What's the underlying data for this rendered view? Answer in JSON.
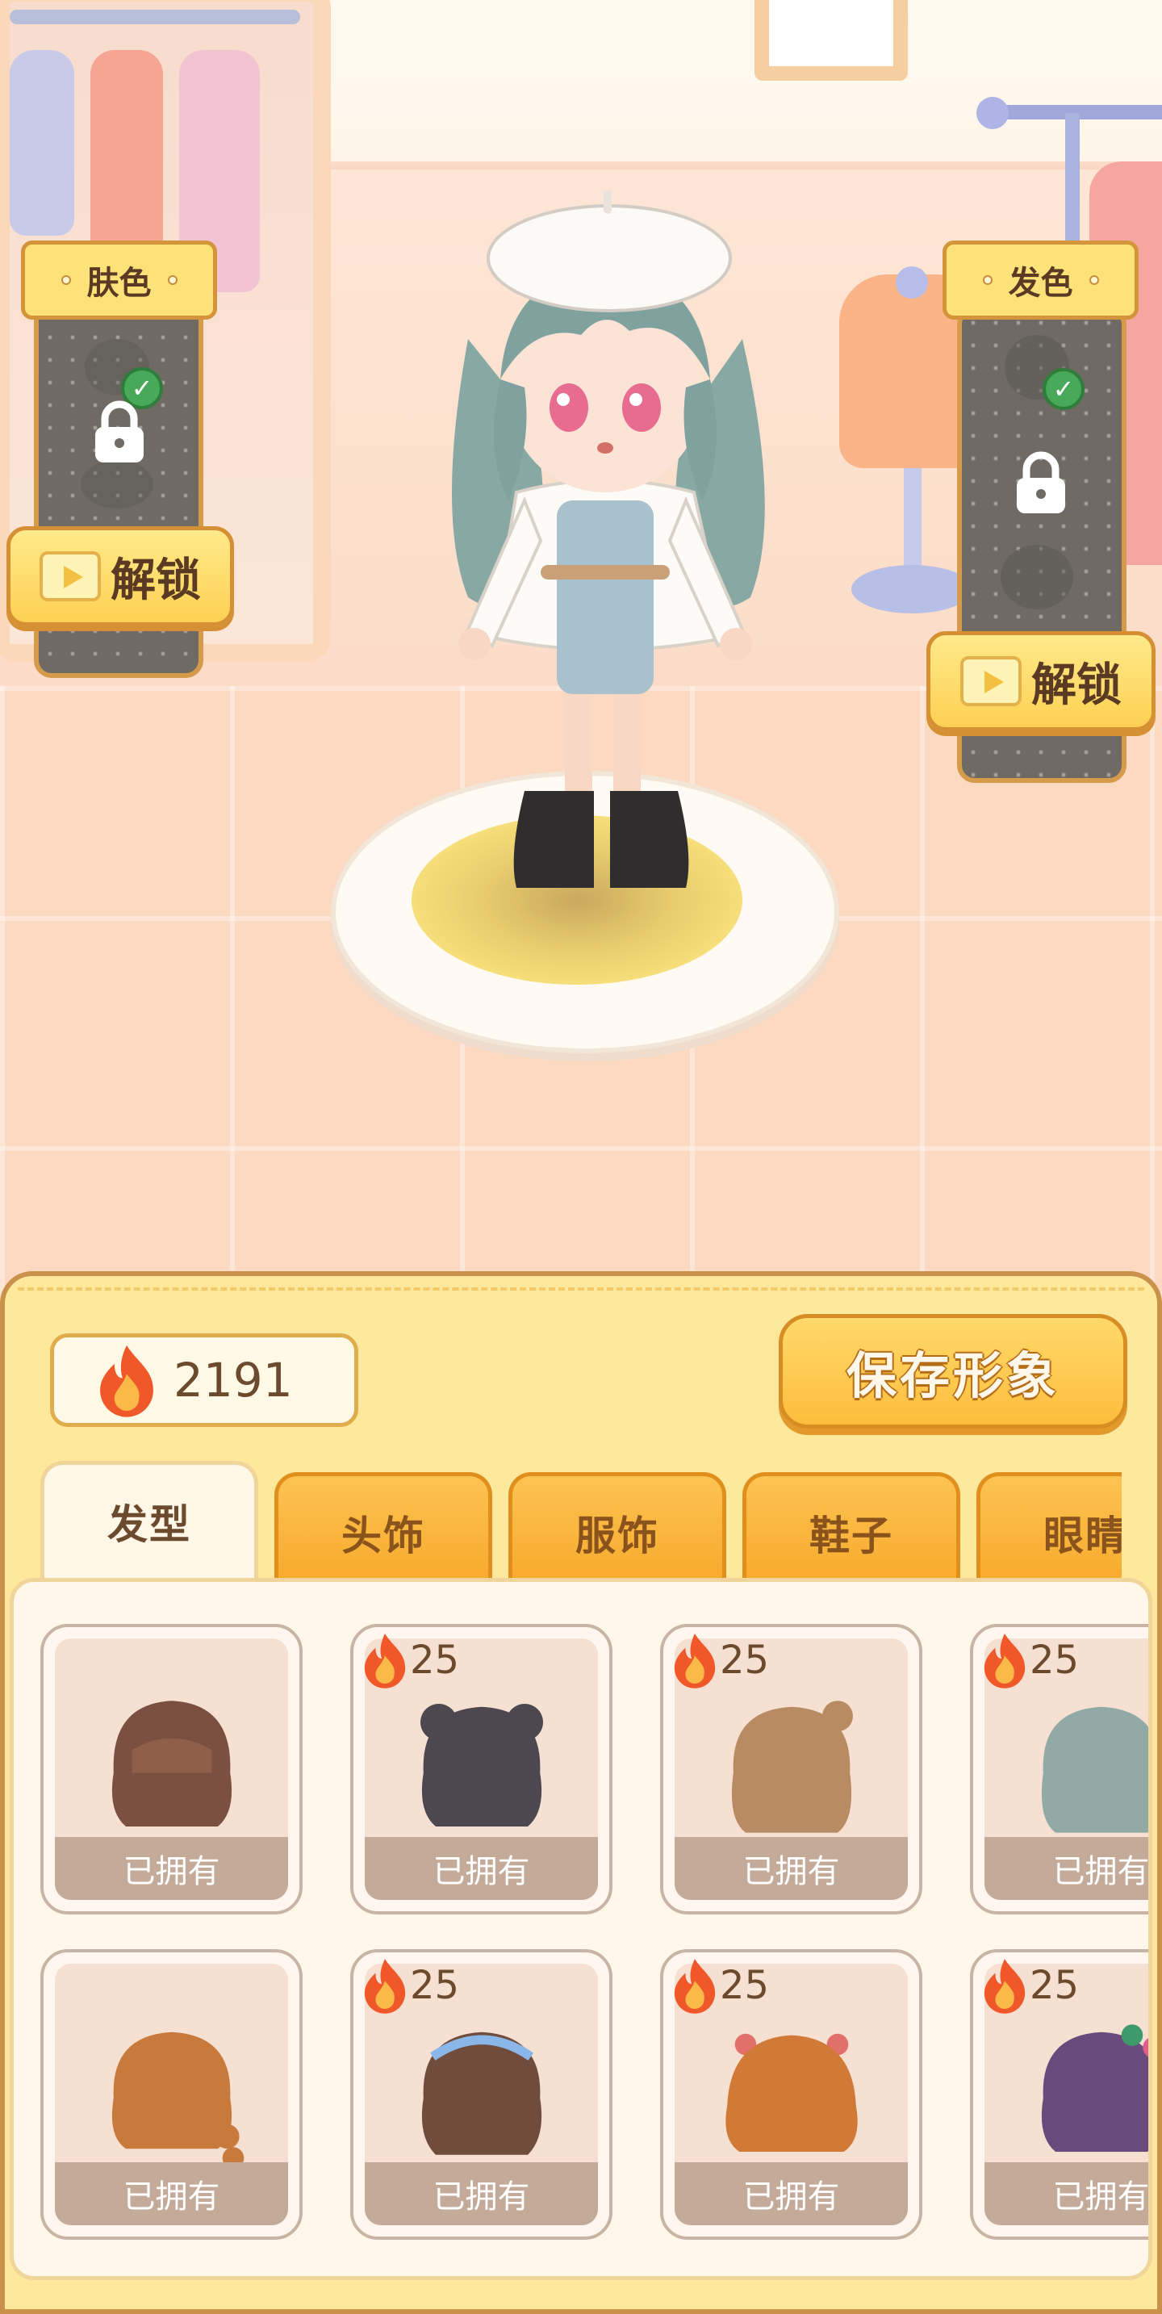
{
  "colors": {
    "flame_outer": "#f0582a",
    "flame_inner": "#fbb947",
    "accent": "#fdbd3c",
    "panel_bg": "#fde89c"
  },
  "skin_panel": {
    "title": "肤色",
    "unlock_label": "解锁",
    "icons": [
      "lock-icon",
      "check-icon",
      "video-icon"
    ]
  },
  "hair_color_panel": {
    "title": "发色",
    "unlock_label": "解锁",
    "icons": [
      "lock-icon",
      "check-icon",
      "video-icon"
    ]
  },
  "currency": {
    "icon": "flame-icon",
    "amount": "2191"
  },
  "save_button": {
    "label": "保存形象"
  },
  "tabs": [
    {
      "label": "发型",
      "active": true
    },
    {
      "label": "头饰",
      "active": false
    },
    {
      "label": "服饰",
      "active": false
    },
    {
      "label": "鞋子",
      "active": false
    },
    {
      "label": "眼睛",
      "active": false
    }
  ],
  "items": [
    {
      "status": "已拥有",
      "price": null,
      "hair_color": "#7b5040"
    },
    {
      "status": "已拥有",
      "price": "25",
      "hair_color": "#4d4750"
    },
    {
      "status": "已拥有",
      "price": "25",
      "hair_color": "#b88b62"
    },
    {
      "status": "已拥有",
      "price": "25",
      "hair_color": "#92aaa6"
    },
    {
      "status": "已拥有",
      "price": null,
      "hair_color": "#c87a3c"
    },
    {
      "status": "已拥有",
      "price": "25",
      "hair_color": "#6f4c3b"
    },
    {
      "status": "已拥有",
      "price": "25",
      "hair_color": "#d17a37"
    },
    {
      "status": "已拥有",
      "price": "25",
      "hair_color": "#6a4a7d"
    }
  ]
}
